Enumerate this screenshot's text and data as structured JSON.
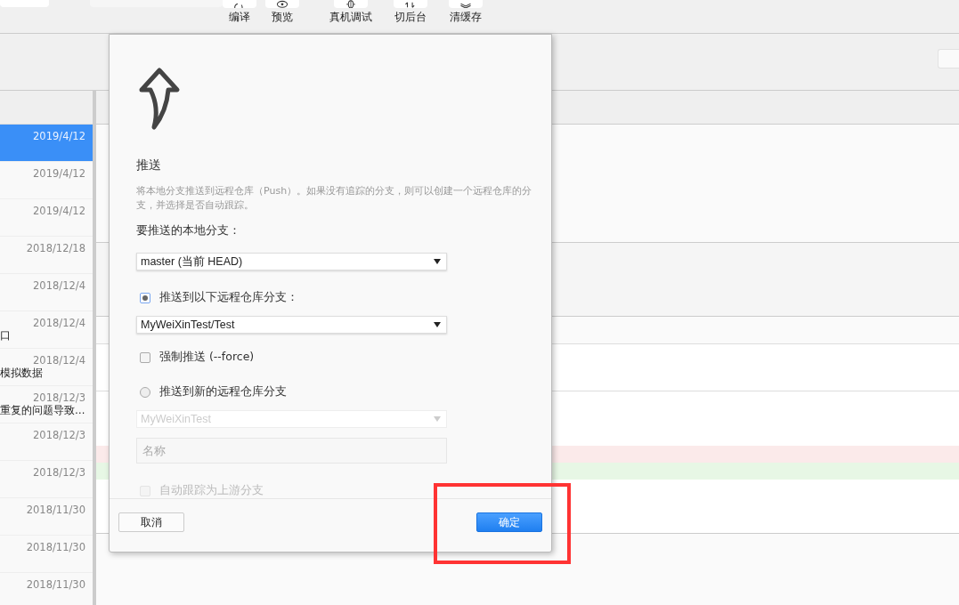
{
  "toolbar": {
    "buttons": [
      {
        "label": "编译"
      },
      {
        "label": "预览"
      },
      {
        "label": "真机调试"
      },
      {
        "label": "切后台"
      },
      {
        "label": "清缓存"
      }
    ]
  },
  "commit_list": {
    "rows": [
      {
        "date": "2019/4/12",
        "selected": true
      },
      {
        "date": "2019/4/12",
        "selected": false
      },
      {
        "date": "2019/4/12",
        "selected": false
      },
      {
        "date": "2018/12/18",
        "selected": false
      },
      {
        "date": "2018/12/4",
        "selected": false
      },
      {
        "date": "2018/12/4",
        "message": "口",
        "selected": false
      },
      {
        "date": "2018/12/4",
        "message": "模拟数据",
        "selected": false
      },
      {
        "date": "2018/12/3",
        "message": "重复的问题导致…",
        "selected": false
      },
      {
        "date": "2018/12/3",
        "selected": false
      },
      {
        "date": "2018/12/3",
        "selected": false
      },
      {
        "date": "2018/11/30",
        "selected": false
      },
      {
        "date": "2018/11/30",
        "selected": false
      },
      {
        "date": "2018/11/30",
        "selected": false
      }
    ]
  },
  "diff": {
    "lines": [
      {
        "kind": "removed"
      },
      {
        "kind": "added"
      }
    ]
  },
  "dialog": {
    "title": "推送",
    "description": "将本地分支推送到远程仓库（Push）。如果没有追踪的分支，则可以创建一个远程仓库的分支，并选择是否自动跟踪。",
    "local_branch_label": "要推送的本地分支：",
    "local_branch": "master (当前 HEAD)",
    "options": [
      {
        "label": "推送到以下远程仓库分支：",
        "selected": true
      },
      {
        "label": "推送到新的远程仓库分支",
        "selected": false
      }
    ],
    "remote_branch": "MyWeiXinTest/Test",
    "force": {
      "label": "强制推送 (--force)",
      "checked": false
    },
    "new_remote": {
      "value": "MyWeiXinTest",
      "disabled": true
    },
    "name_field": {
      "placeholder": "名称",
      "disabled": true
    },
    "auto_track": {
      "label": "自动跟踪为上游分支",
      "checked": false,
      "disabled": true
    },
    "cancel_button": "取消",
    "ok_button": "确定"
  },
  "annotations": [
    {
      "kind": "box"
    }
  ]
}
